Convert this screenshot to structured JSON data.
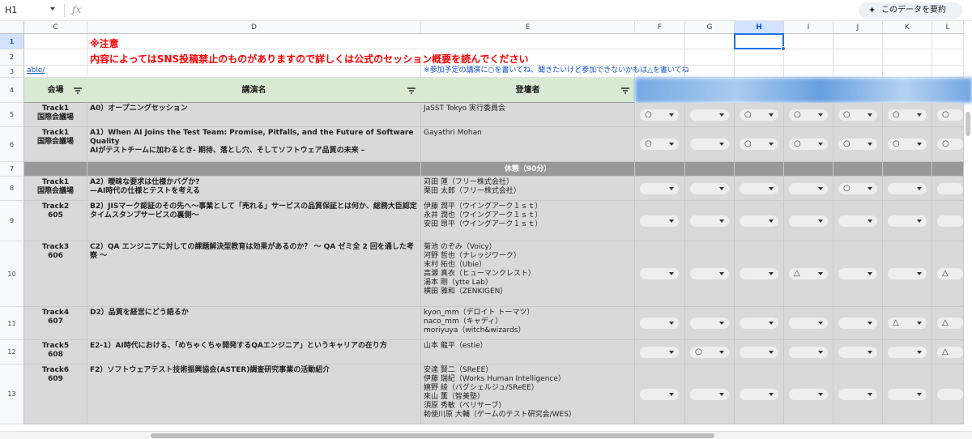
{
  "formula_bar": {
    "cell_ref": "H1",
    "fx_icon": "fx-icon",
    "summarize_label": "このデータを要約",
    "summarize_icon": "sparkle-icon"
  },
  "columns": [
    "C",
    "D",
    "E",
    "F",
    "G",
    "H",
    "I",
    "J",
    "K",
    "L"
  ],
  "selected_column": "H",
  "rows": [
    "1",
    "2",
    "3",
    "4",
    "5",
    "6",
    "7",
    "8",
    "9",
    "10",
    "11",
    "12",
    "13"
  ],
  "selected_row": "1",
  "notice": {
    "line1": "※注意",
    "line2": "内容によってはSNS投稿禁止のものがありますので詳しくは公式のセッション概要を読んでください"
  },
  "row3": {
    "link": "able/",
    "hint": "※参加予定の講演に○を書いてね、聞きたいけど参加できないかもは△を書いてね"
  },
  "header": {
    "venue": "会場",
    "talk": "講演名",
    "speaker": "登壇者"
  },
  "sessions": [
    {
      "row": "5",
      "track": [
        "Track1",
        "国際会議場"
      ],
      "title": [
        "A0）オープニングセッション"
      ],
      "speakers": [
        "JaSST Tokyo 実行委員会"
      ],
      "marks": [
        "○",
        "",
        "○",
        "○",
        "○",
        "○",
        "○"
      ]
    },
    {
      "row": "6",
      "track": [
        "Track1",
        "国際会議場"
      ],
      "title": [
        "A1）When AI Joins the Test Team: Promise, Pitfalls, and the Future of Software Quality",
        "AIがテストチームに加わるとき- 期待、落とし穴、そしてソフトウェア品質の未来 –"
      ],
      "speakers": [
        "Gayathri Mohan"
      ],
      "marks": [
        "○",
        "",
        "○",
        "○",
        "○",
        "○",
        "○"
      ]
    },
    {
      "row": "8",
      "track": [
        "Track1",
        "国際会議場"
      ],
      "title": [
        "A2）曖昧な要求は仕様かバグか?",
        "—AI時代の仕様とテストを考える"
      ],
      "speakers": [
        "苅田 蓮（フリー株式会社）",
        "栗田 太郎（フリー株式会社）"
      ],
      "marks": [
        "",
        "",
        "",
        "",
        "○",
        "",
        ""
      ]
    },
    {
      "row": "9",
      "track": [
        "Track2",
        "605"
      ],
      "title": [
        "B2）JISマーク認証のその先へ〜事業として「売れる」サービスの品質保証とは何か、総務大臣認定タイムスタンプサービスの裏側〜"
      ],
      "speakers": [
        "伊藤 潤平（ウイングアーク１ｓｔ）",
        "永井 潤也（ウイングアーク１ｓｔ）",
        "安田 昂平（ウイングアーク１ｓｔ）"
      ],
      "marks": [
        "",
        "",
        "",
        "",
        "",
        "",
        ""
      ]
    },
    {
      "row": "10",
      "track": [
        "Track3",
        "606"
      ],
      "title": [
        "C2）QA エンジニアに対しての課題解決型教育は効果があるのか？ 〜 QA ゼミ全 2 回を通した考察 〜"
      ],
      "speakers": [
        "菊池 のぞみ（Voicy）",
        "河野 哲也（ナレッジワーク）",
        "末村 拓也（Ubie）",
        "高瀬 真衣（ヒューマンクレスト）",
        "湯本 剛（ytte Lab）",
        "横田 雅和（ZENKIGEN）"
      ],
      "marks": [
        "",
        "",
        "",
        "△",
        "",
        "",
        "△"
      ]
    },
    {
      "row": "11",
      "track": [
        "Track4",
        "607"
      ],
      "title": [
        "D2）品質を経営にどう語るか"
      ],
      "speakers": [
        "kyon_mm（デロイト トーマツ）",
        "naco_mm（キャディ）",
        "moriyuya（witch&wizards）"
      ],
      "marks": [
        "",
        "",
        "",
        "",
        "",
        "△",
        "△"
      ]
    },
    {
      "row": "12",
      "track": [
        "Track5",
        "608"
      ],
      "title": [
        "E2-1）AI時代における、「めちゃくちゃ開発するQAエンジニア」というキャリアの在り方"
      ],
      "speakers": [
        "山本 龍平（estie）"
      ],
      "marks": [
        "",
        "○",
        "",
        "",
        "",
        "",
        "△"
      ]
    },
    {
      "row": "13",
      "track": [
        "Track6",
        "609"
      ],
      "title": [
        "F2）ソフトウェアテスト技術振興協会(ASTER)調査研究事業の活動紹介"
      ],
      "speakers": [
        "安達 賢二（SReEE）",
        "伊藤 瑞紀（Works Human Intelligence）",
        "嬉野 綾（バグシェルジュ/SReEE）",
        "來山 薫（智美塾）",
        "須原 秀敏（ベリサーブ）",
        "勅使川原 大輔（ゲームのテスト研究会/WES）"
      ],
      "marks": [
        "",
        "",
        "",
        "",
        "",
        "",
        ""
      ]
    }
  ],
  "break_row": {
    "row": "7",
    "label": "休憩（90分）"
  },
  "icons": {
    "filter": "filter-icon",
    "dropdown": "chevron-down-icon"
  }
}
